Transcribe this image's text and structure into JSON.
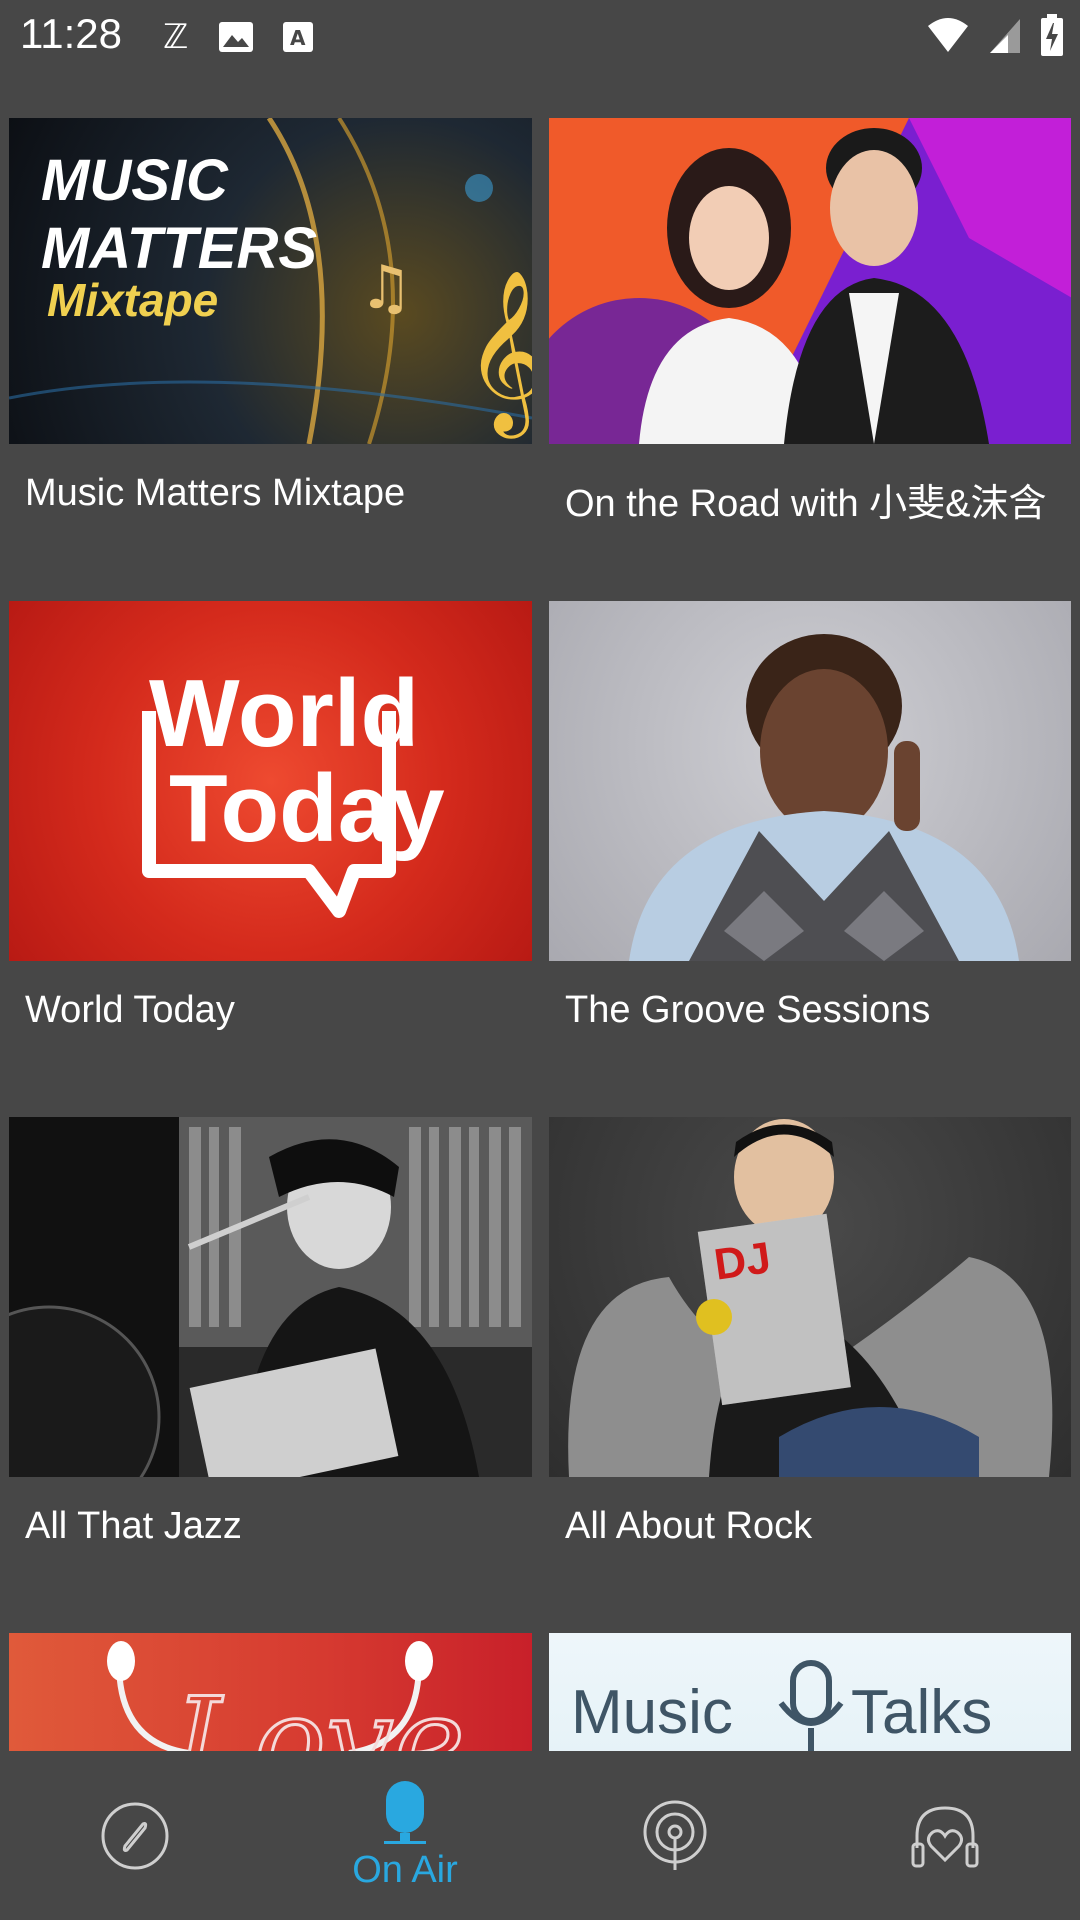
{
  "status_bar": {
    "time": "11:28",
    "left_icons": [
      "ez-icon",
      "image-icon",
      "font-icon"
    ],
    "right_icons": [
      "wifi-icon",
      "signal-icon",
      "battery-charging-icon"
    ]
  },
  "header": {
    "title": "On Air"
  },
  "programs": [
    {
      "title": "Music Matters Mixtape",
      "art": {
        "line1": "MUSIC",
        "line2": "MATTERS",
        "line3": "Mixtape"
      }
    },
    {
      "title": "On the Road with 小斐&沫含"
    },
    {
      "title": "World Today",
      "art": {
        "line1": "World",
        "line2": "Today"
      }
    },
    {
      "title": "The Groove Sessions"
    },
    {
      "title": "All That Jazz"
    },
    {
      "title": "All About Rock",
      "art": {
        "magazine": "DJ"
      }
    },
    {
      "title": "",
      "art": {
        "text": "Love"
      }
    },
    {
      "title": "",
      "art": {
        "left": "Music",
        "right": "Talks"
      }
    }
  ],
  "bottom_nav": {
    "items": [
      {
        "icon": "compass-icon",
        "label": ""
      },
      {
        "icon": "microphone-icon",
        "label": "On Air",
        "active": true
      },
      {
        "icon": "podcast-icon",
        "label": ""
      },
      {
        "icon": "headphones-heart-icon",
        "label": ""
      }
    ],
    "active_color": "#29a8e0"
  },
  "colors": {
    "background": "#474747",
    "accent": "#29a8e0"
  }
}
